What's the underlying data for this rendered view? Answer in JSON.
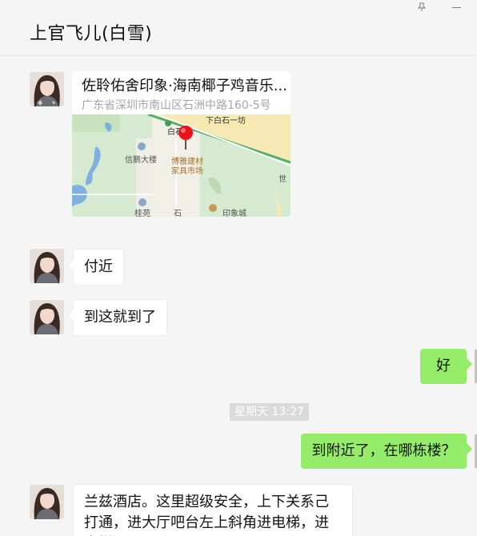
{
  "window": {
    "title": "上官飞儿(白雪)",
    "pin_icon": "pin-icon",
    "minimize_icon": "minimize-icon"
  },
  "messages": [
    {
      "type": "location",
      "from": "other",
      "name": "佐聆佑舍印象·海南椰子鸡音乐...",
      "address": "广东省深圳市南山区石洲中路160-5号",
      "map_labels": {
        "road": "下白石一坊",
        "station": "白石洲",
        "poi_left": "信鹏大楼",
        "poi_center": "博雅建材家具市场",
        "poi_bottom_left": "桂苑",
        "poi_bottom": "印象城",
        "stone": "石",
        "edge": "世"
      }
    },
    {
      "type": "text",
      "from": "other",
      "text": "付近"
    },
    {
      "type": "text",
      "from": "other",
      "text": "到这就到了"
    },
    {
      "type": "text",
      "from": "me",
      "text": "好"
    },
    {
      "type": "time",
      "text": "星期天 13:27"
    },
    {
      "type": "text",
      "from": "me",
      "text": "到附近了，在哪栋楼？"
    },
    {
      "type": "text",
      "from": "other",
      "text": "兰兹酒店。这里超级安全，上下关系己打通，进大厅吧台左上斜角进电梯，进电梯"
    }
  ],
  "colors": {
    "background": "#f5f5f5",
    "my_bubble": "#95ec69",
    "other_bubble": "#ffffff",
    "time_badge": "#dadada"
  }
}
